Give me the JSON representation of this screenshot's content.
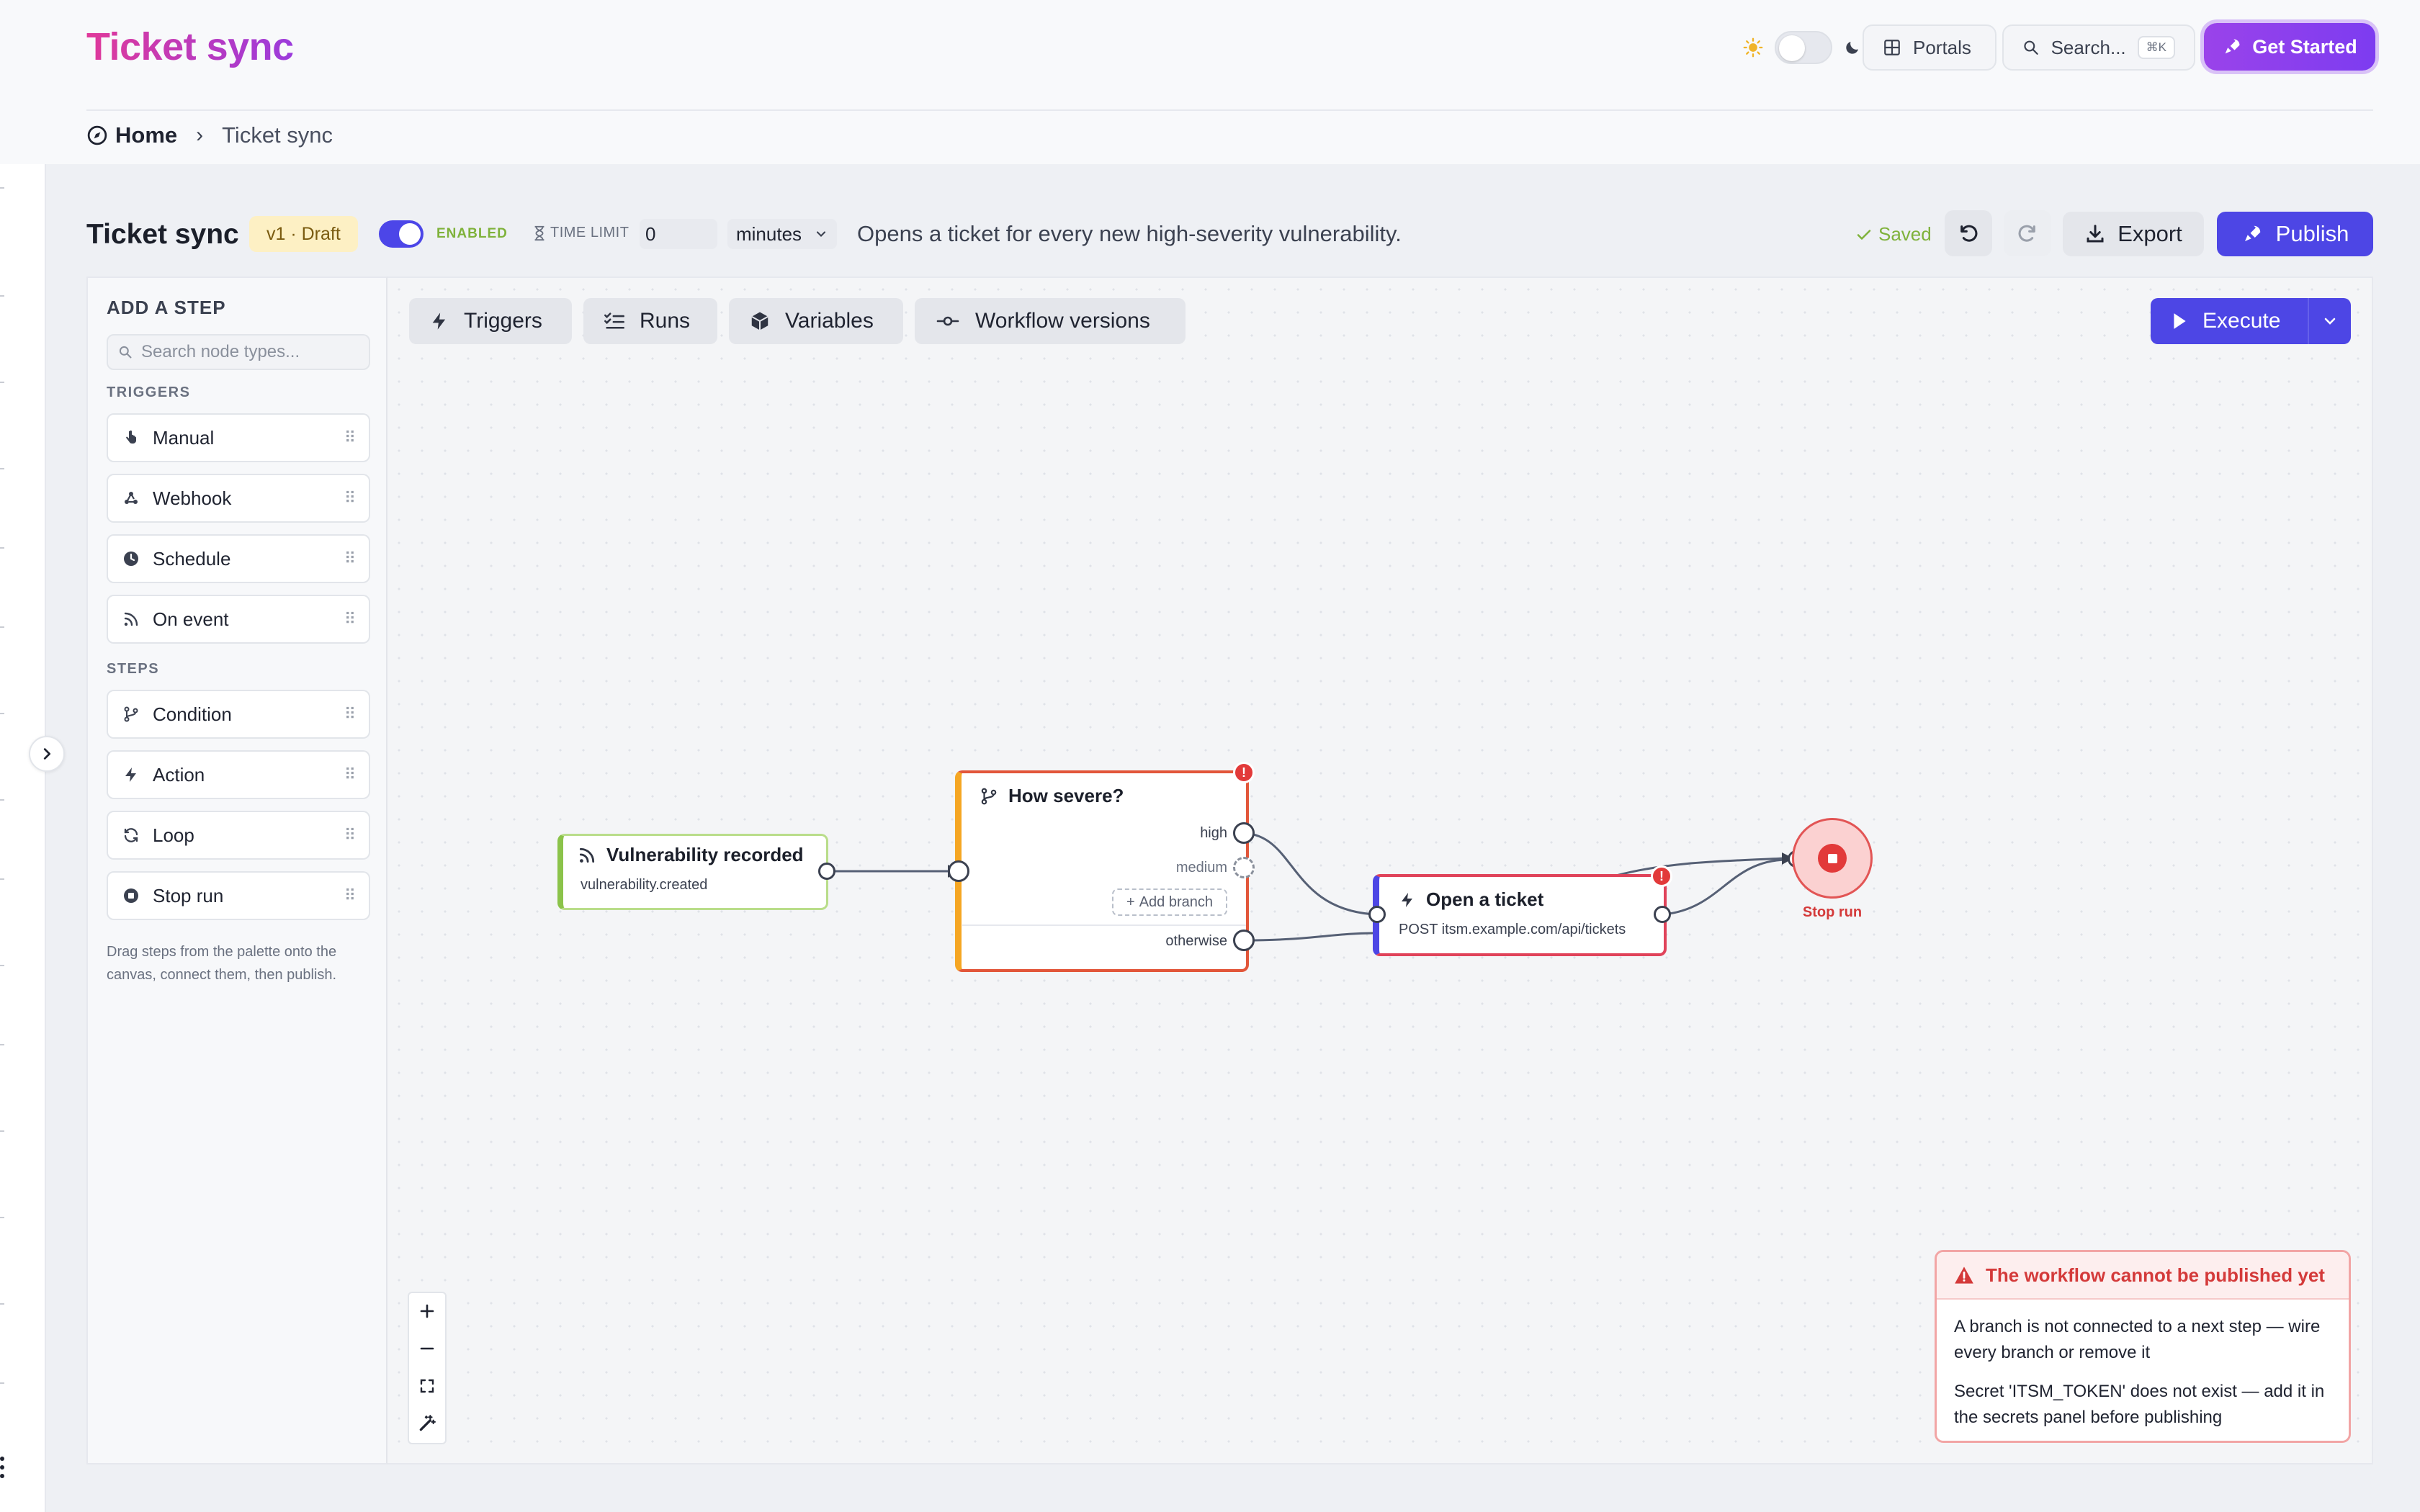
{
  "header": {
    "brand": "Ticket sync",
    "portals_label": "Portals",
    "search_label": "Search...",
    "search_shortcut": "⌘K",
    "cta_label": "Get Started"
  },
  "breadcrumb": {
    "home": "Home",
    "current": "Ticket sync"
  },
  "workflow": {
    "title": "Ticket sync",
    "version": "v1 · Draft",
    "enabled_label": "ENABLED",
    "enabled": true,
    "time_limit_label": "TIME LIMIT",
    "time_limit_value": "0",
    "time_unit": "minutes",
    "description": "Opens a ticket for every new high-severity vulnerability.",
    "saved_label": "Saved",
    "export_label": "Export",
    "publish_label": "Publish"
  },
  "palette": {
    "heading": "ADD A STEP",
    "search_placeholder": "Search node types...",
    "triggers_heading": "TRIGGERS",
    "triggers": [
      {
        "label": "Manual",
        "icon": "hand-pointer-icon"
      },
      {
        "label": "Webhook",
        "icon": "webhook-icon"
      },
      {
        "label": "Schedule",
        "icon": "clock-icon"
      },
      {
        "label": "On event",
        "icon": "rss-icon"
      }
    ],
    "steps_heading": "STEPS",
    "steps": [
      {
        "label": "Condition",
        "icon": "branch-icon"
      },
      {
        "label": "Action",
        "icon": "bolt-icon"
      },
      {
        "label": "Loop",
        "icon": "loop-icon"
      },
      {
        "label": "Stop run",
        "icon": "stop-icon"
      }
    ],
    "help": "Drag steps from the palette onto the canvas, connect them, then publish."
  },
  "toolbar": {
    "tabs": [
      {
        "label": "Triggers",
        "icon": "bolt-icon"
      },
      {
        "label": "Runs",
        "icon": "list-check-icon"
      },
      {
        "label": "Variables",
        "icon": "cube-icon"
      },
      {
        "label": "Workflow versions",
        "icon": "commit-icon"
      }
    ],
    "execute_label": "Execute"
  },
  "nodes": {
    "trigger": {
      "title": "Vulnerability recorded",
      "subtitle": "vulnerability.created"
    },
    "condition": {
      "title": "How severe?",
      "branches": [
        "high",
        "medium",
        "otherwise"
      ],
      "add_branch": "Add branch"
    },
    "action": {
      "title": "Open a ticket",
      "subtitle": "POST itsm.example.com/api/tickets"
    },
    "stop": {
      "label": "Stop run"
    }
  },
  "error_panel": {
    "title": "The workflow cannot be published yet",
    "messages": [
      "A branch is not connected to a next step — wire every branch or remove it",
      "Secret 'ITSM_TOKEN' does not exist — add it in the secrets panel before publishing"
    ]
  },
  "colors": {
    "brand_gradient_start": "#e0399a",
    "brand_gradient_end": "#9b3bdc",
    "primary": "#4d46e5",
    "enabled_green": "#7fb23b",
    "trigger_accent": "#8bc34a",
    "condition_accent": "#f5a623",
    "condition_border": "#e2563a",
    "action_accent": "#4d46e5",
    "error_red": "#e23a3a"
  }
}
